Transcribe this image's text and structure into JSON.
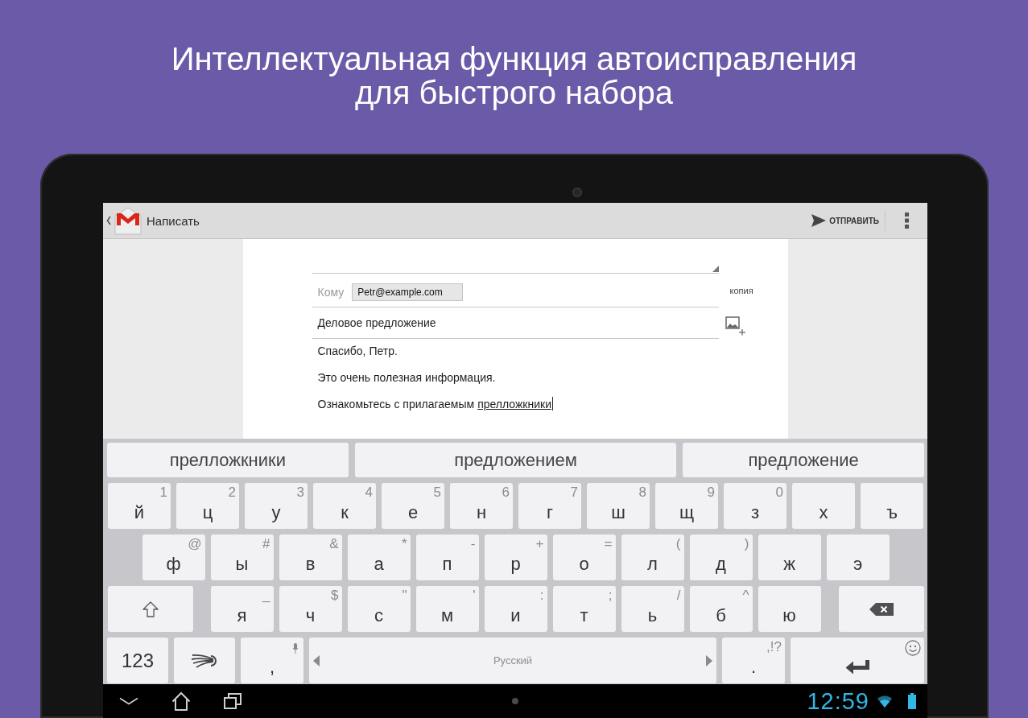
{
  "headline": {
    "lines": [
      "Интеллектуальная функция автоисправления",
      "для быстрого набора"
    ]
  },
  "action_bar": {
    "title": "Написать",
    "action": "ОТПРАВИТЬ"
  },
  "compose": {
    "to": {
      "label": "Кому",
      "recipients": [
        "Petr@example.com"
      ]
    },
    "cc": "копия",
    "subject": "Деловое предложение",
    "body": [
      {
        "text": "Спасибо, Петр.",
        "cursor": false
      },
      {
        "text": "Это очень полезная информация.",
        "cursor": false
      },
      {
        "text": "Ознакомьтесь с прилагаемым",
        "composing": "прелложкники",
        "cursor": true
      }
    ]
  },
  "keyboard": {
    "suggestions": [
      "прелложкники",
      "предложением",
      "предложение"
    ],
    "rows": [
      {
        "keys": [
          {
            "kind": "letter",
            "label": "й",
            "hint": "1"
          },
          {
            "kind": "letter",
            "label": "ц",
            "hint": "2"
          },
          {
            "kind": "letter",
            "label": "у",
            "hint": "3"
          },
          {
            "kind": "letter",
            "label": "к",
            "hint": "4"
          },
          {
            "kind": "letter",
            "label": "е",
            "hint": "5"
          },
          {
            "kind": "letter",
            "label": "н",
            "hint": "6"
          },
          {
            "kind": "letter",
            "label": "г",
            "hint": "7"
          },
          {
            "kind": "letter",
            "label": "ш",
            "hint": "8"
          },
          {
            "kind": "letter",
            "label": "щ",
            "hint": "9"
          },
          {
            "kind": "letter",
            "label": "з",
            "hint": "0"
          },
          {
            "kind": "letter",
            "label": "х"
          },
          {
            "kind": "letter",
            "label": "ъ"
          }
        ]
      },
      {
        "keys": [
          {
            "kind": "letter",
            "label": "ф",
            "hint": "@"
          },
          {
            "kind": "letter",
            "label": "ы",
            "hint": "#"
          },
          {
            "kind": "letter",
            "label": "в",
            "hint": "&"
          },
          {
            "kind": "letter",
            "label": "а",
            "hint": "*"
          },
          {
            "kind": "letter",
            "label": "п",
            "hint": "-"
          },
          {
            "kind": "letter",
            "label": "р",
            "hint": "+"
          },
          {
            "kind": "letter",
            "label": "о",
            "hint": "="
          },
          {
            "kind": "letter",
            "label": "л",
            "hint": "("
          },
          {
            "kind": "letter",
            "label": "д",
            "hint": ")"
          },
          {
            "kind": "letter",
            "label": "ж"
          },
          {
            "kind": "letter",
            "label": "э"
          }
        ]
      },
      {
        "keys": [
          {
            "kind": "shift"
          },
          {
            "kind": "letter",
            "label": "я",
            "hint": "_"
          },
          {
            "kind": "letter",
            "label": "ч",
            "hint": "$"
          },
          {
            "kind": "letter",
            "label": "с",
            "hint": "\""
          },
          {
            "kind": "letter",
            "label": "м",
            "hint": "'"
          },
          {
            "kind": "letter",
            "label": "и",
            "hint": ":"
          },
          {
            "kind": "letter",
            "label": "т",
            "hint": ";"
          },
          {
            "kind": "letter",
            "label": "ь",
            "hint": "/"
          },
          {
            "kind": "letter",
            "label": "б",
            "hint": "^"
          },
          {
            "kind": "letter",
            "label": "ю"
          },
          {
            "kind": "backspace"
          }
        ]
      },
      {
        "keys": [
          {
            "kind": "symbols",
            "label": "123"
          },
          {
            "kind": "swype"
          },
          {
            "kind": "voice",
            "label": ","
          },
          {
            "kind": "space",
            "label": "Русский"
          },
          {
            "kind": "letter",
            "label": ".",
            "hint": ",!?"
          },
          {
            "kind": "enter"
          }
        ]
      }
    ]
  },
  "status_bar": {
    "time": "12:59"
  }
}
